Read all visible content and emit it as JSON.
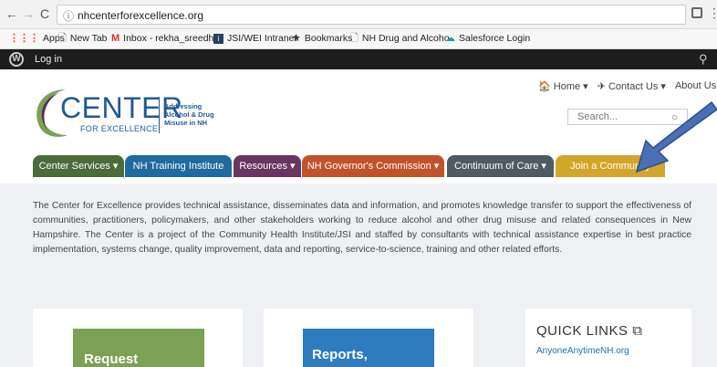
{
  "browser": {
    "back": "←",
    "forward": "→",
    "reload": "C",
    "info": "ⓘ",
    "url": "nhcenterforexcellence.org",
    "star": "☆",
    "menu": "⋮"
  },
  "bookmarks": [
    {
      "label": "Apps",
      "icon": "apps-grid-icon"
    },
    {
      "label": "New Tab",
      "icon": "page-icon"
    },
    {
      "label": "Inbox - rekha_sreedh",
      "icon": "gmail-icon"
    },
    {
      "label": "JSI/WEI Intranet",
      "icon": "intranet-icon"
    },
    {
      "label": "Bookmarks",
      "icon": "star-icon"
    },
    {
      "label": "NH Drug and Alcoho",
      "icon": "page-icon"
    },
    {
      "label": "Salesforce Login",
      "icon": "salesforce-cloud-icon"
    }
  ],
  "admin_bar": {
    "logo": "W",
    "login": "Log in",
    "search": "🔍"
  },
  "logo": {
    "word": "CENTER",
    "sub": "FOR EXCELLENCE",
    "tagline": [
      "Addressing",
      "Alcohol & Drug",
      "Misuse in NH"
    ],
    "colors": {
      "primary": "#1f5a94",
      "swoosh_green": "#7aa154",
      "swoosh_purple": "#5b2a5a"
    }
  },
  "top_links": [
    {
      "label": "🏠 Home ▾"
    },
    {
      "label": "✈ Contact Us ▾"
    },
    {
      "label": "About Us"
    }
  ],
  "search": {
    "placeholder": "Search...",
    "icon": "○"
  },
  "menu": [
    {
      "label": "Center Services ▾",
      "color": "#4a6b3a"
    },
    {
      "label": "NH Training Institute",
      "color": "#1f6aa1"
    },
    {
      "label": "Resources ▾",
      "color": "#6a3560"
    },
    {
      "label": "NH Governor's Commission ▾",
      "color": "#c2522a"
    },
    {
      "label": "Continuum of Care ▾",
      "color": "#4f5a63"
    },
    {
      "label": "Join a Community",
      "color": "#d4a52b"
    }
  ],
  "intro": "The Center for Excellence provides technical assistance, disseminates data and information, and promotes knowledge transfer to support the effectiveness of communities, practitioners, policymakers, and other stakeholders working to reduce alcohol and other drug misuse and related consequences in New Hampshire.  The Center is a project of the Community Health Institute/JSI and staffed by consultants with technical assistance expertise in best practice implementation, systems change, quality improvement, data and reporting, service-to-science, training and other related efforts.",
  "cards": {
    "request": "Request",
    "reports": "Reports,",
    "quick_links_title": "QUICK LINKS",
    "quick_links_icon": "⧉",
    "quick_link": "AnyoneAnytimeNH.org"
  }
}
